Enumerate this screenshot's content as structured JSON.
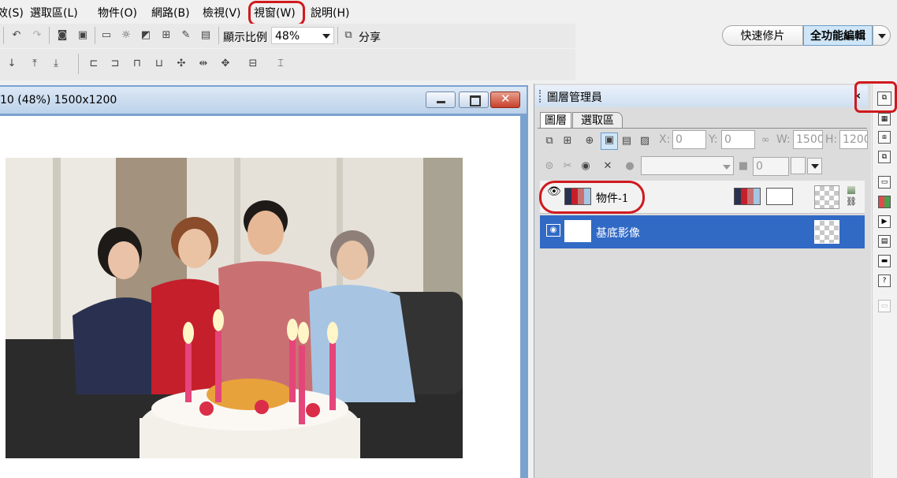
{
  "menubar": {
    "items": [
      {
        "label": "效(S)"
      },
      {
        "label": "選取區(L)"
      },
      {
        "label": "物件(O)"
      },
      {
        "label": "網路(B)"
      },
      {
        "label": "檢視(V)"
      },
      {
        "label": "視窗(W)"
      },
      {
        "label": "說明(H)"
      }
    ]
  },
  "toolbar": {
    "zoom_label": "顯示比例",
    "zoom_value": "48%",
    "share_label": "分享"
  },
  "modes": {
    "quick_fix": "快速修片",
    "full_edit": "全功能編輯"
  },
  "document": {
    "title": "10 (48%) 1500x1200"
  },
  "layer_panel": {
    "title": "圖層管理員",
    "tabs": [
      "圖層",
      "選取區"
    ],
    "x_label": "X:",
    "x_value": "0",
    "y_label": "Y:",
    "y_value": "0",
    "w_label": "W:",
    "w_value": "1500",
    "h_label": "H:",
    "h_value": "1200",
    "opacity_value": "0",
    "layers": [
      {
        "name": "物件-1",
        "selected": false
      },
      {
        "name": "基底影像",
        "selected": true
      }
    ]
  },
  "colors": {
    "highlight_ring": "#d0191e",
    "selected_row": "#316ac5",
    "full_edit_bg": "#cfe6f8"
  }
}
